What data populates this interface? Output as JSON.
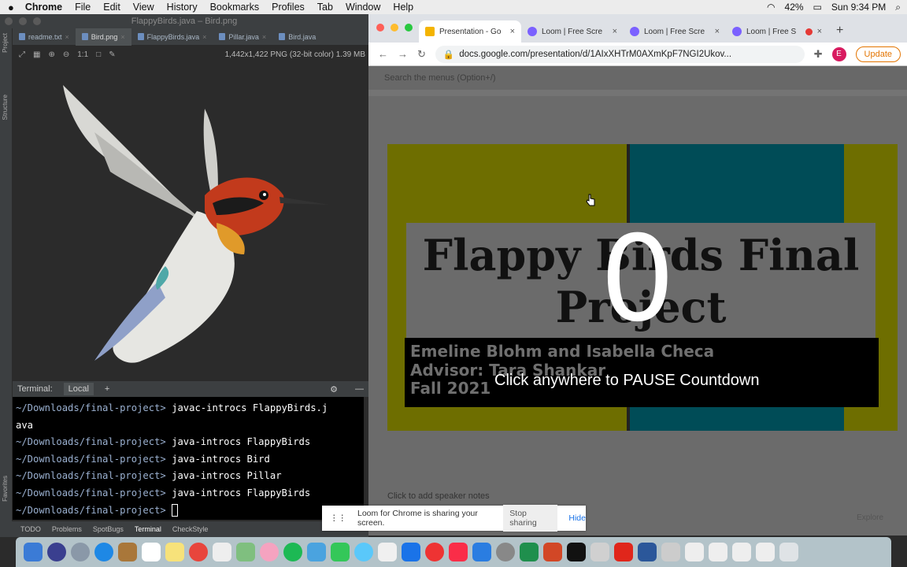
{
  "menubar": {
    "app": "Chrome",
    "items": [
      "File",
      "Edit",
      "View",
      "History",
      "Bookmarks",
      "Profiles",
      "Tab",
      "Window",
      "Help"
    ],
    "battery": "42%",
    "clock": "Sun 9:34 PM"
  },
  "ide": {
    "window_title": "FlappyBirds.java – Bird.png",
    "tabs": [
      "readme.txt",
      "Bird.png",
      "FlappyBirds.java",
      "Pillar.java",
      "Bird.java"
    ],
    "active_tab": "Bird.png",
    "side_labels": [
      "Project",
      "Structure",
      "Favorites"
    ],
    "image_info": "1,442x1,422 PNG (32-bit color) 1.39 MB",
    "zoom_label": "1:1",
    "terminal": {
      "title": "Terminal:",
      "tab": "Local",
      "lines": [
        {
          "prompt": "~/Downloads/final-project>",
          "cmd": "javac-introcs FlappyBirds.j"
        },
        {
          "prompt": "",
          "cmd": "ava"
        },
        {
          "prompt": "~/Downloads/final-project>",
          "cmd": "java-introcs FlappyBirds"
        },
        {
          "prompt": "~/Downloads/final-project>",
          "cmd": "java-introcs Bird"
        },
        {
          "prompt": "~/Downloads/final-project>",
          "cmd": "java-introcs Pillar"
        },
        {
          "prompt": "~/Downloads/final-project>",
          "cmd": "java-introcs FlappyBirds"
        },
        {
          "prompt": "~/Downloads/final-project>",
          "cmd": ""
        }
      ]
    },
    "status_tabs": [
      "TODO",
      "Problems",
      "SpotBugs",
      "Terminal",
      "CheckStyle"
    ]
  },
  "chrome": {
    "tabs": [
      {
        "title": "Presentation - Go",
        "icon": "slides-icon"
      },
      {
        "title": "Loom | Free Scre",
        "icon": "loom-icon"
      },
      {
        "title": "Loom | Free Scre",
        "icon": "loom-icon"
      },
      {
        "title": "Loom | Free S",
        "icon": "loom-icon"
      }
    ],
    "url": "docs.google.com/presentation/d/1AIxXHTrM0AXmKpF7NGI2Ukov...",
    "update_label": "Update",
    "avatar_letter": "E"
  },
  "slides": {
    "search_placeholder": "Search the menus (Option+/)",
    "title_line1": "Flappy Birds Final",
    "title_line2": "Project",
    "subtitle_lines": [
      "Emeline Blohm and Isabella Checa",
      "Advisor: Tara Shankar",
      "Fall 2021"
    ],
    "countdown": "0",
    "countdown_msg": "Click anywhere to PAUSE Countdown",
    "notes_placeholder": "Click to add speaker notes",
    "explore_label": "Explore"
  },
  "loom_bar": {
    "message": "Loom for Chrome is sharing your screen.",
    "stop": "Stop sharing",
    "hide": "Hide"
  },
  "colors": {
    "slide_yellow": "#d4d400",
    "slide_teal": "#00a8be",
    "record_red": "#e53935"
  }
}
